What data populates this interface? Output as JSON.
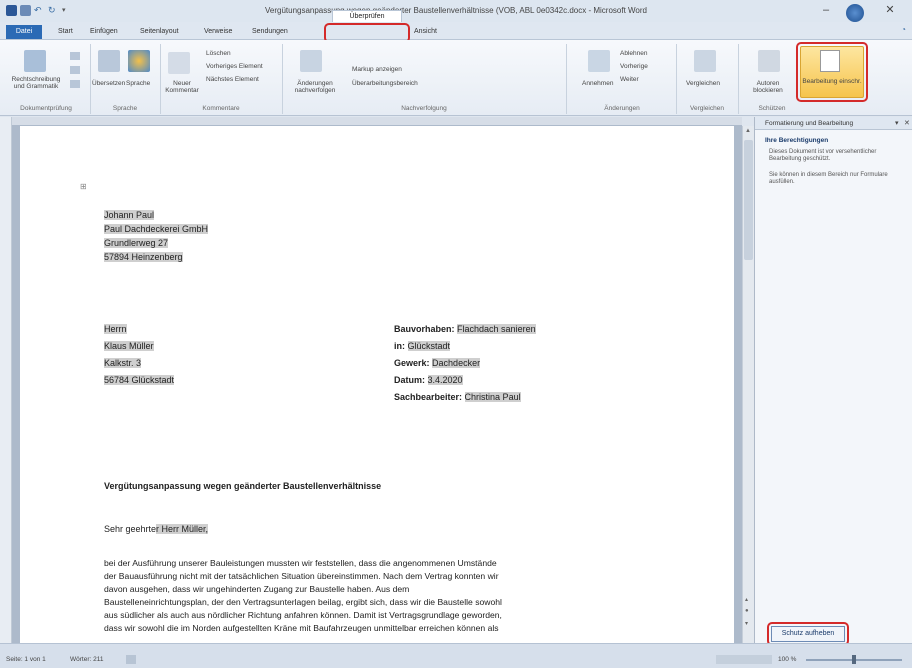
{
  "window": {
    "title": "Vergütungsanpassung wegen geänderter Baustellenverhältnisse (VOB, ABL 0e0342c.docx - Microsoft Word"
  },
  "tabs": [
    {
      "label": "Datei"
    },
    {
      "label": "Start"
    },
    {
      "label": "Einfügen"
    },
    {
      "label": "Seitenlayout"
    },
    {
      "label": "Verweise"
    },
    {
      "label": "Sendungen"
    },
    {
      "label": "Überprüfen"
    },
    {
      "label": "Ansicht"
    }
  ],
  "ribbon": {
    "groups": [
      {
        "label": "Dokumentprüfung"
      },
      {
        "label": "Sprache"
      },
      {
        "label": "Kommentare"
      },
      {
        "label": "Nachverfolgung"
      },
      {
        "label": "Änderungen"
      },
      {
        "label": "Vergleichen"
      },
      {
        "label": "Schützen"
      }
    ],
    "buttons": {
      "spelling": "Rechtschreibung und Grammatik",
      "translate": "Übersetzen",
      "language": "Sprache",
      "new_comment": "Neuer Kommentar",
      "delete": "Löschen",
      "prev": "Vorheriges Element",
      "next": "Nächstes Element",
      "track": "Änderungen nachverfolgen",
      "markup": "Markup anzeigen",
      "review_pane": "Überarbeitungsbereich",
      "accept": "Annehmen",
      "reject": "Ablehnen",
      "prev_change": "Vorherige",
      "next_change": "Weiter",
      "compare": "Vergleichen",
      "block_authors": "Autoren blockieren",
      "restrict": "Bearbeitung einschr."
    }
  },
  "taskpane": {
    "title": "Formatierung und Bearbeitung",
    "subtitle": "Ihre Berechtigungen",
    "text1": "Dieses Dokument ist vor versehentlicher Bearbeitung geschützt.",
    "text2": "Sie können in diesem Bereich nur Formulare ausfüllen.",
    "stop_protection": "Schutz aufheben"
  },
  "document": {
    "sender": [
      "Johann Paul",
      "Paul Dachdeckerei GmbH",
      "Grundlerweg 27",
      "57894 Heinzenberg"
    ],
    "recipient": [
      "Herrn",
      "Klaus Müller",
      "Kalkstr. 3",
      "56784 Glückstadt"
    ],
    "project": [
      {
        "label": "Bauvorhaben:",
        "value": "Flachdach sanieren"
      },
      {
        "label": "in:",
        "value": "Glückstadt"
      },
      {
        "label": "Gewerk:",
        "value": "Dachdecker"
      },
      {
        "label": "Datum:",
        "value": "3.4.2020"
      },
      {
        "label": "Sachbearbeiter:",
        "value": "Christina Paul"
      }
    ],
    "subject": "Vergütungsanpassung wegen geänderter Baustellenverhältnisse",
    "salutation_prefix": "Sehr geehrte",
    "salutation_name": "r Herr Müller,",
    "body": [
      "bei der Ausführung unserer Bauleistungen mussten wir feststellen, dass die angenommenen Umstände",
      "der Bauausführung nicht mit der tatsächlichen Situation übereinstimmen. Nach dem Vertrag konnten wir",
      "davon ausgehen, dass wir ungehinderten Zugang zur Baustelle haben. Aus dem",
      "Baustelleneinrichtungsplan, der den Vertragsunterlagen beilag, ergibt sich, dass wir die Baustelle sowohl",
      "aus südlicher als auch aus nördlicher Richtung anfahren können. Damit ist Vertragsgrundlage geworden,",
      "dass wir sowohl die im Norden aufgestellten Kräne mit Baufahrzeugen unmittelbar erreichen können als"
    ]
  },
  "status": {
    "page": "Seite: 1 von 1",
    "words": "Wörter: 211",
    "zoom": "100 %"
  }
}
